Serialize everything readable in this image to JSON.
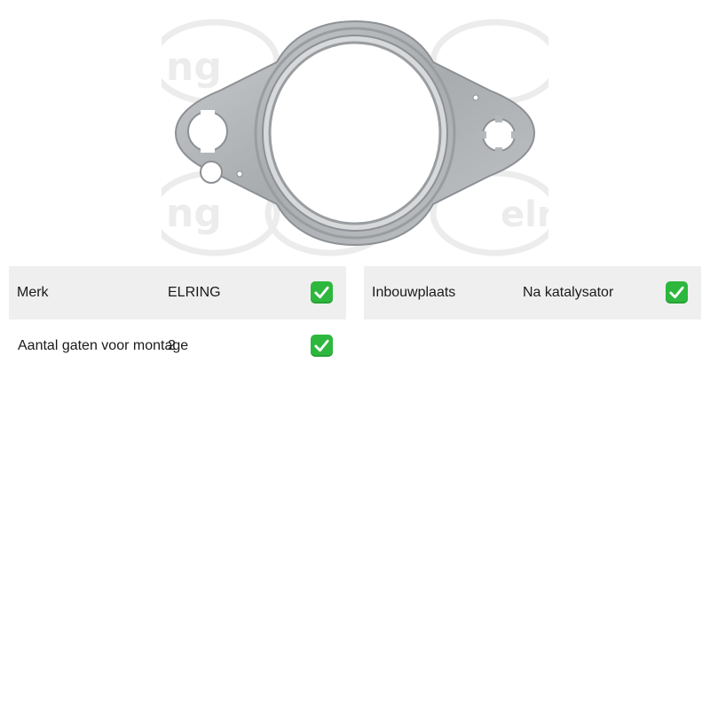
{
  "product": {
    "image_alt": "Pakking, uitlaatbocht",
    "brand_watermark": "elring"
  },
  "specs": [
    {
      "label": "Merk",
      "value": "ELRING",
      "icon": "check-mark-icon"
    },
    {
      "label": "Inbouwplaats",
      "value": "Na katalysator",
      "icon": "check-mark-icon"
    },
    {
      "label": "Aantal gaten voor montage",
      "value": "2",
      "icon": "check-mark-icon"
    }
  ],
  "colors": {
    "row_background": "#efefef",
    "check_green": "#2db83d",
    "gasket_metal": "#b5b8bb"
  }
}
